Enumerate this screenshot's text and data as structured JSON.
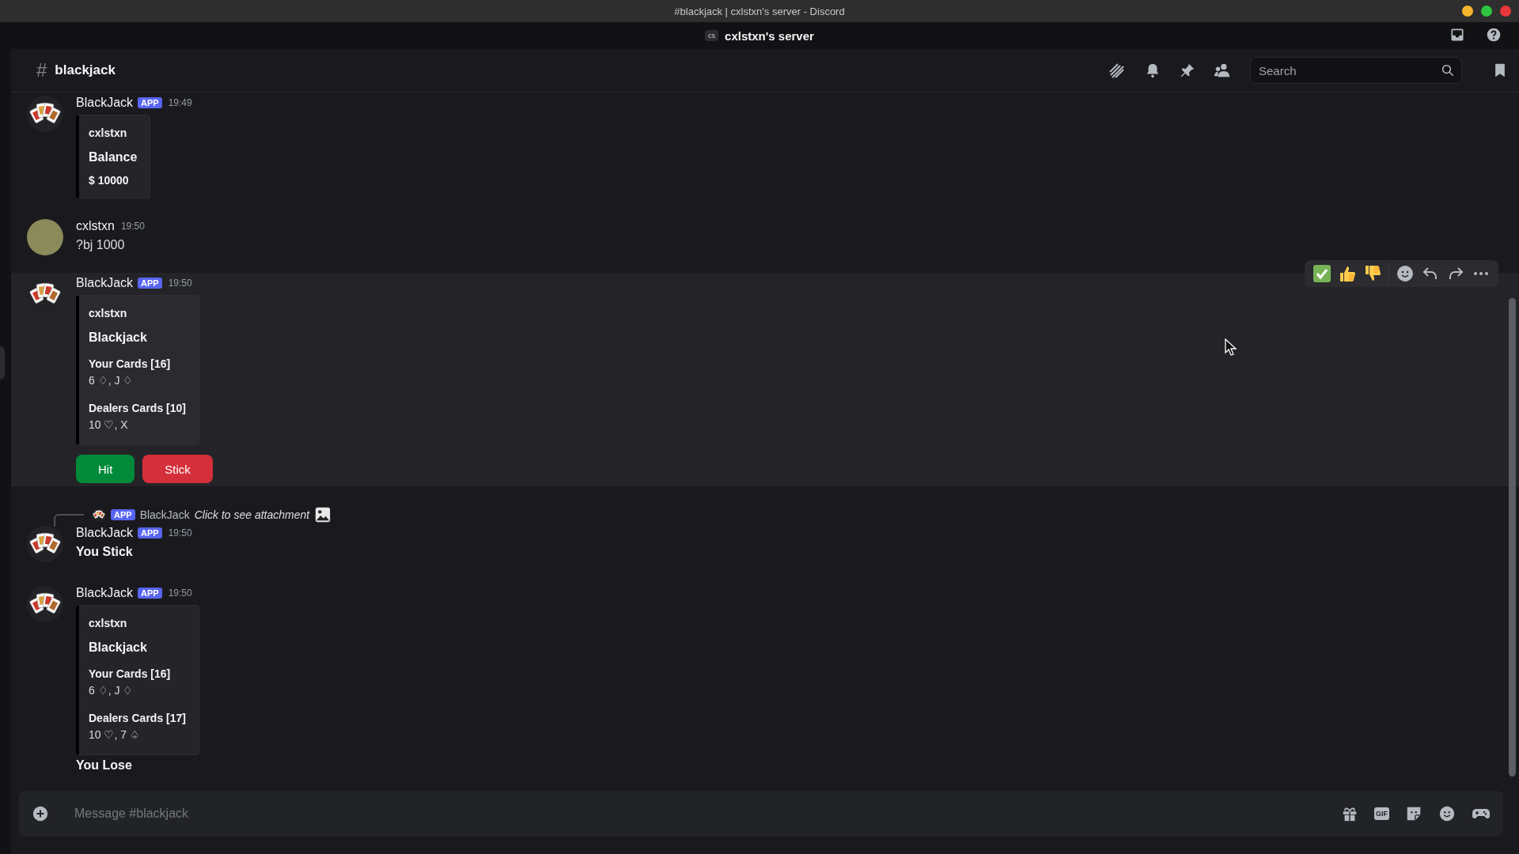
{
  "window": {
    "title": "#blackjack | cxlstxn's server - Discord"
  },
  "server": {
    "initials": "cs",
    "name": "cxlstxn's server"
  },
  "channel": {
    "prefix": "#",
    "name": "blackjack"
  },
  "search": {
    "placeholder": "Search"
  },
  "messages": [
    {
      "kind": "bot",
      "author": "BlackJack",
      "badge": "APP",
      "time": "19:49",
      "highlighted": false,
      "blocks": [
        {
          "kind": "embed",
          "author": "cxlstxn",
          "title": "Balance",
          "description": "$ 10000"
        }
      ]
    },
    {
      "kind": "user",
      "author": "cxlstxn",
      "time": "19:50",
      "highlighted": false,
      "blocks": [
        {
          "kind": "text",
          "text": "?bj 1000",
          "bold": false
        }
      ]
    },
    {
      "kind": "bot",
      "author": "BlackJack",
      "badge": "APP",
      "time": "19:50",
      "highlighted": true,
      "blocks": [
        {
          "kind": "embed",
          "author": "cxlstxn",
          "title": "Blackjack",
          "fields": [
            {
              "name": "Your Cards [16]",
              "value": "6 ♢, J ♢"
            },
            {
              "name": "Dealers Cards [10]",
              "value": "10 ♡, X"
            }
          ]
        },
        {
          "kind": "buttons",
          "buttons": [
            {
              "label": "Hit",
              "kind": "success"
            },
            {
              "label": "Stick",
              "kind": "danger"
            }
          ]
        }
      ]
    },
    {
      "kind": "bot",
      "reply": {
        "badge": "APP",
        "author": "BlackJack",
        "text": "Click to see attachment"
      },
      "author": "BlackJack",
      "badge": "APP",
      "time": "19:50",
      "highlighted": false,
      "blocks": [
        {
          "kind": "text",
          "text": "You Stick",
          "bold": true
        }
      ]
    },
    {
      "kind": "bot",
      "author": "BlackJack",
      "badge": "APP",
      "time": "19:50",
      "highlighted": false,
      "blocks": [
        {
          "kind": "embed",
          "author": "cxlstxn",
          "title": "Blackjack",
          "fields": [
            {
              "name": "Your Cards [16]",
              "value": "6 ♢, J ♢"
            },
            {
              "name": "Dealers Cards [17]",
              "value": "10 ♡, 7 ♤"
            }
          ]
        },
        {
          "kind": "text",
          "text": "You Lose",
          "bold": true
        }
      ]
    }
  ],
  "composer": {
    "placeholder": "Message #blackjack",
    "gif_label": "GIF"
  }
}
